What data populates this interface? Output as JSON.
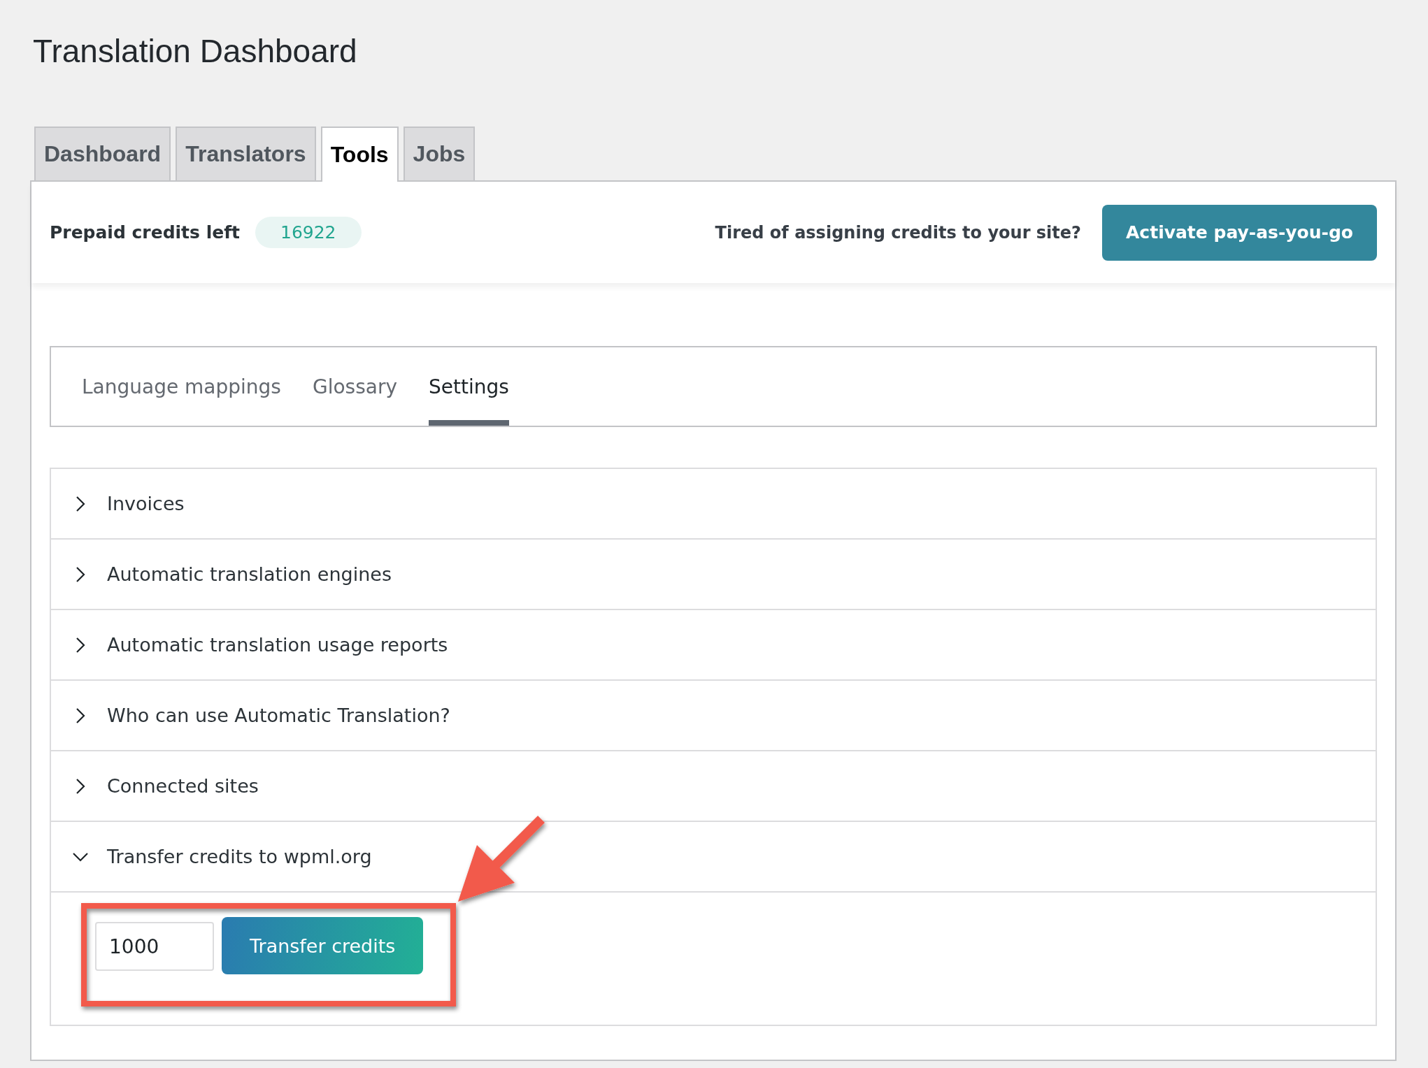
{
  "title": "Translation Dashboard",
  "tabs": [
    {
      "label": "Dashboard",
      "selected": false
    },
    {
      "label": "Translators",
      "selected": false
    },
    {
      "label": "Tools",
      "selected": true
    },
    {
      "label": "Jobs",
      "selected": false
    }
  ],
  "credits": {
    "label": "Prepaid credits left",
    "value": "16922"
  },
  "promo": {
    "text": "Tired of assigning credits to your site?",
    "button": "Activate pay-as-you-go"
  },
  "subtabs": [
    {
      "label": "Language mappings",
      "selected": false
    },
    {
      "label": "Glossary",
      "selected": false
    },
    {
      "label": "Settings",
      "selected": true
    }
  ],
  "settings": [
    {
      "label": "Invoices",
      "expanded": false
    },
    {
      "label": "Automatic translation engines",
      "expanded": false
    },
    {
      "label": "Automatic translation usage reports",
      "expanded": false
    },
    {
      "label": "Who can use Automatic Translation?",
      "expanded": false
    },
    {
      "label": "Connected sites",
      "expanded": false
    },
    {
      "label": "Transfer credits to wpml.org",
      "expanded": true,
      "amount": "1000",
      "button": "Transfer credits"
    }
  ]
}
